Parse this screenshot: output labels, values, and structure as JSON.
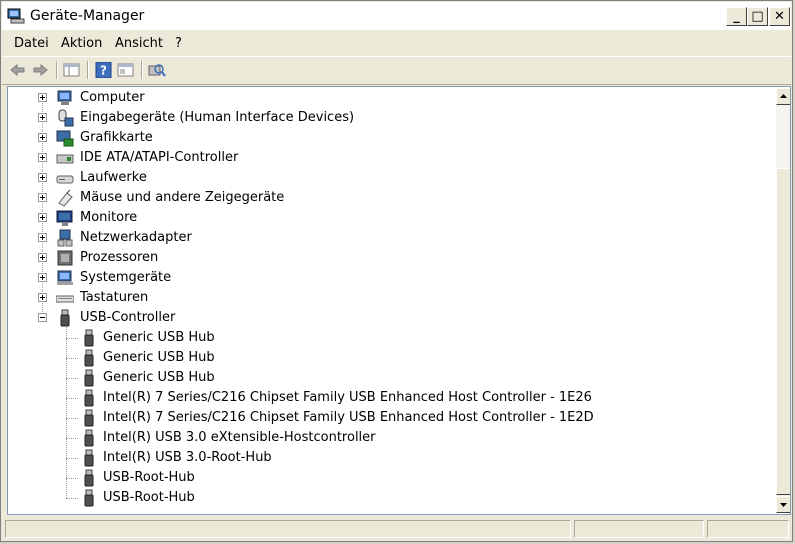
{
  "window": {
    "title": "Geräte-Manager"
  },
  "title_buttons": {
    "minimize": "_",
    "maximize": "□",
    "close": "✕"
  },
  "menu": [
    "Datei",
    "Aktion",
    "Ansicht",
    "?"
  ],
  "toolbar": [
    "back-arrow-icon",
    "forward-arrow-icon",
    "show-hide-console-tree-icon",
    "help-icon",
    "properties-icon",
    "scan-hardware-icon"
  ],
  "tree": {
    "categories": [
      {
        "label": "Computer",
        "icon": "computer-icon",
        "expanded": false
      },
      {
        "label": "Eingabegeräte (Human Interface Devices)",
        "icon": "hid-icon",
        "expanded": false
      },
      {
        "label": "Grafikkarte",
        "icon": "display-adapter-icon",
        "expanded": false
      },
      {
        "label": "IDE ATA/ATAPI-Controller",
        "icon": "ide-controller-icon",
        "expanded": false
      },
      {
        "label": "Laufwerke",
        "icon": "disk-drive-icon",
        "expanded": false
      },
      {
        "label": "Mäuse und andere Zeigegeräte",
        "icon": "mouse-icon",
        "expanded": false
      },
      {
        "label": "Monitore",
        "icon": "monitor-icon",
        "expanded": false
      },
      {
        "label": "Netzwerkadapter",
        "icon": "network-adapter-icon",
        "expanded": false
      },
      {
        "label": "Prozessoren",
        "icon": "processor-icon",
        "expanded": false
      },
      {
        "label": "Systemgeräte",
        "icon": "system-devices-icon",
        "expanded": false
      },
      {
        "label": "Tastaturen",
        "icon": "keyboard-icon",
        "expanded": false
      },
      {
        "label": "USB-Controller",
        "icon": "usb-icon",
        "expanded": true
      }
    ],
    "usb_children": [
      "Generic USB Hub",
      "Generic USB Hub",
      "Generic USB Hub",
      "Intel(R) 7 Series/C216 Chipset Family USB Enhanced Host Controller - 1E26",
      "Intel(R) 7 Series/C216 Chipset Family USB Enhanced Host Controller - 1E2D",
      "Intel(R) USB 3.0 eXtensible-Hostcontroller",
      "Intel(R) USB 3.0-Root-Hub",
      "USB-Root-Hub",
      "USB-Root-Hub"
    ]
  },
  "statusbar": {
    "panels": [
      "",
      "",
      ""
    ]
  }
}
